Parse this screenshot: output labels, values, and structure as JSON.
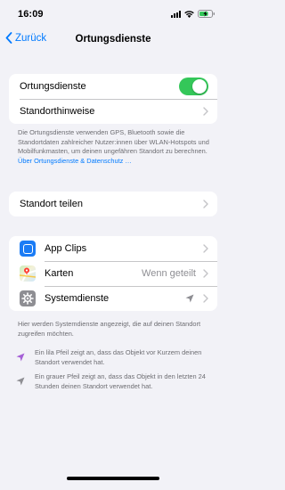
{
  "status_bar": {
    "time": "16:09"
  },
  "nav": {
    "back_label": "Zurück",
    "title": "Ortungsdienste"
  },
  "group1": {
    "toggle_label": "Ortungsdienste",
    "toggle_on": true,
    "hints_label": "Standorthinweise"
  },
  "footnote1": {
    "text": "Die Ortungsdienste verwenden GPS, Bluetooth sowie die Standortdaten zahlreicher Nutzer:innen über WLAN-Hotspots und Mobilfunkmasten, um deinen ungefähren Standort zu berechnen. ",
    "link": "Über Ortungsdienste & Datenschutz …"
  },
  "share": {
    "label": "Standort teilen"
  },
  "apps": [
    {
      "name": "App Clips",
      "value": ""
    },
    {
      "name": "Karten",
      "value": "Wenn geteilt"
    },
    {
      "name": "Systemdienste",
      "value": ""
    }
  ],
  "footnote2": {
    "text": "Hier werden Systemdienste angezeigt, die auf deinen Standort zugreifen möchten."
  },
  "legend": {
    "purple": "Ein lila Pfeil zeigt an, dass das Objekt vor Kurzem deinen Standort verwendet hat.",
    "gray": "Ein grauer Pfeil zeigt an, dass das Objekt in den letzten 24 Stunden deinen Standort verwendet hat."
  },
  "colors": {
    "accent": "#007aff",
    "toggle_on": "#34c759",
    "purple_arrow": "#a55fd6",
    "gray_arrow": "#8e8e93"
  }
}
